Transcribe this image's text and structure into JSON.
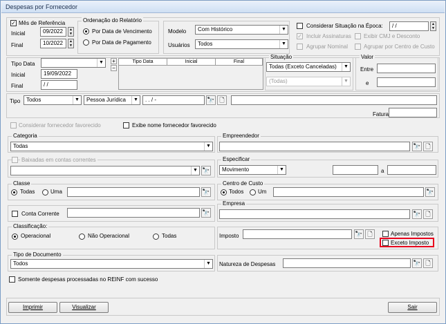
{
  "window": {
    "title": "Despesas por Fornecedor"
  },
  "referencia": {
    "mes_label": "Mês de Referência",
    "mes_checked": true,
    "inicial_label": "Inicial",
    "final_label": "Final",
    "inicial_value": "09/2022",
    "final_value": "10/2022"
  },
  "ordenacao": {
    "title": "Ordenação do Relatório",
    "option1": "Por Data de Vencimento",
    "option2": "Por Data de Pagamento"
  },
  "modelo": {
    "label": "Modelo",
    "value": "Com Histórico"
  },
  "usuarios": {
    "label": "Usuários",
    "value": "Todos"
  },
  "options": {
    "considerar_situacao": "Considerar Situação na Época:",
    "situacao_epoca_value": " / /",
    "incluir_assinaturas": "Incluir Assinaturas",
    "exibir_cmj": "Exibir CMJ e Desconto",
    "agrupar_nominal": "Agrupar Nominal",
    "agrupar_centro": "Agrupar por Centro de Custo"
  },
  "tipo_data": {
    "label": "Tipo Data",
    "value": "",
    "inicial_label": "Inicial",
    "final_label": "Final",
    "inicial_value": "19/09/2022",
    "final_value": " / /",
    "plus": "+",
    "minus": "−",
    "col1": "Tipo Data",
    "col2": "Inicial",
    "col3": "Final"
  },
  "situacao": {
    "title": "Situação",
    "value": "Todas (Exceto Canceladas)",
    "sub_value": "(Todas)"
  },
  "valor": {
    "title": "Valor",
    "entre_label": "Entre",
    "e_label": "e"
  },
  "tipo": {
    "label": "Tipo",
    "value": "Todos",
    "pessoa_value": "Pessoa Jurídica",
    "doc_value": " .  .  /  -",
    "fatura_label": "Fatura"
  },
  "fornecedor": {
    "considerar_favorecido": "Considerar fornecedor favorecido",
    "exibe_nome": "Exibe nome fornecedor favorecido"
  },
  "categoria": {
    "title": "Categoria",
    "value": "Todas"
  },
  "empreendedor": {
    "title": "Empreendedor"
  },
  "baixadas": {
    "title": "Baixadas em contas correntes"
  },
  "especificar": {
    "title": "Especificar",
    "value": "Movimento",
    "a_label": "a"
  },
  "classe": {
    "title": "Classe",
    "todas": "Todas",
    "uma": "Uma"
  },
  "centro_custo": {
    "title": "Centro de Custo",
    "todos": "Todos",
    "um": "Um"
  },
  "conta_corrente": {
    "label": "Conta Corrente"
  },
  "empresa": {
    "title": "Empresa"
  },
  "classificacao": {
    "title": "Classificação:",
    "op1": "Operacional",
    "op2": "Não Operacional",
    "op3": "Todas"
  },
  "imposto": {
    "label": "Imposto",
    "apenas": "Apenas Impostos",
    "exceto": "Exceto Imposto"
  },
  "tipo_documento": {
    "title": "Tipo de Documento",
    "value": "Todos"
  },
  "natureza": {
    "label": "Natureza de Despesas"
  },
  "reinf": {
    "label": "Somente despesas processadas no REINF com sucesso"
  },
  "buttons": {
    "imprimir": "Imprimir",
    "visualizar": "Visualizar",
    "sair": "Sair"
  },
  "icons": {
    "binoculars": "binoculars-icon",
    "new": "new-document-icon",
    "dropdown": "chevron-down-icon"
  }
}
